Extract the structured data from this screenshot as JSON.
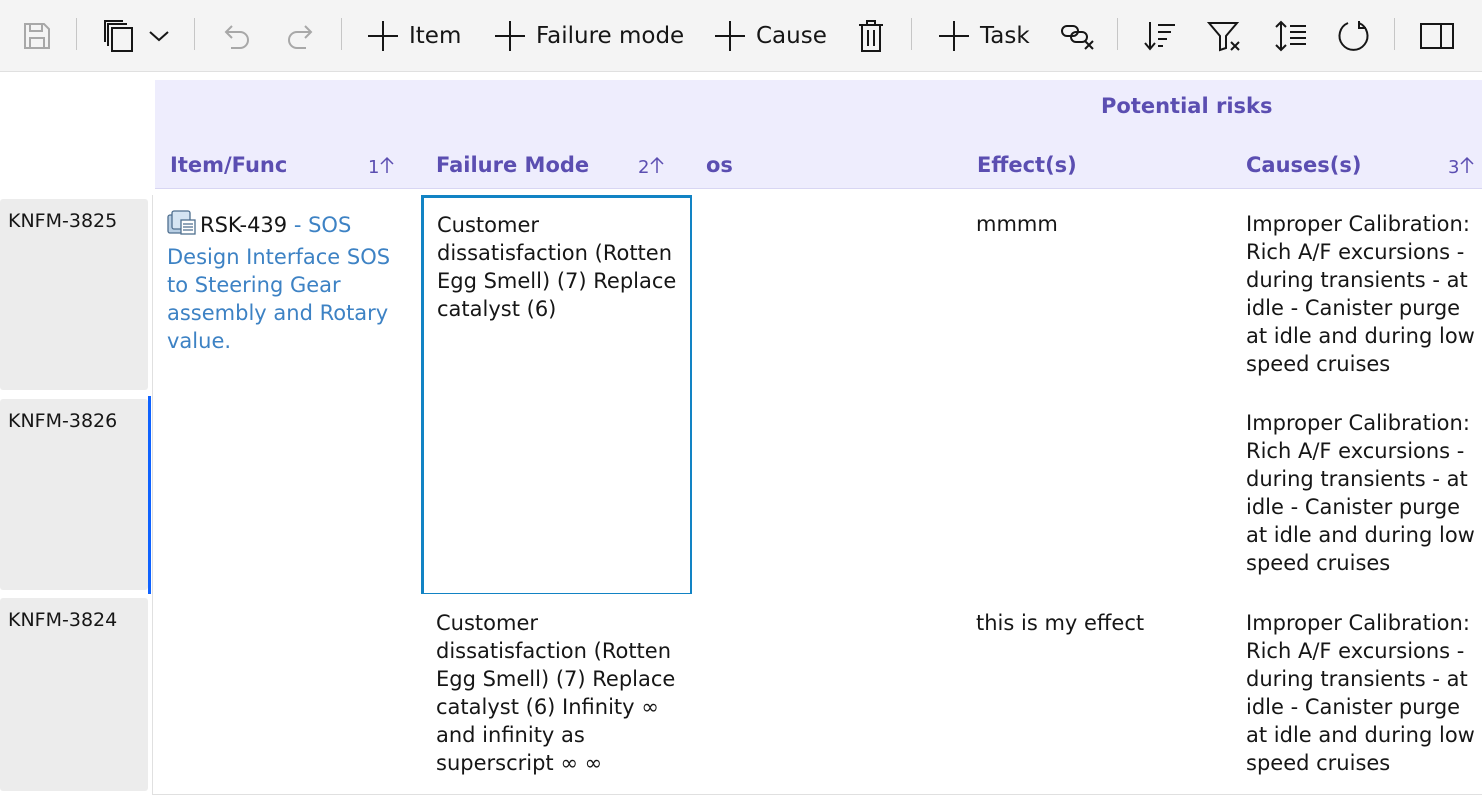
{
  "toolbar": {
    "save_icon": "save-icon",
    "copy_icon": "copy-icon",
    "add_item": "Item",
    "add_failure_mode": "Failure mode",
    "add_cause": "Cause",
    "add_task": "Task"
  },
  "header": {
    "group_label": "Potential risks",
    "columns": [
      {
        "label": "Item/Func",
        "sort": "1"
      },
      {
        "label": "Failure Mode",
        "sort": "2"
      },
      {
        "label": "os",
        "sort": ""
      },
      {
        "label": "Effect(s)",
        "sort": ""
      },
      {
        "label": "Causes(s)",
        "sort": "3"
      }
    ]
  },
  "rows": [
    {
      "id": "KNFM-3825"
    },
    {
      "id": "KNFM-3826"
    },
    {
      "id": "KNFM-3824"
    }
  ],
  "item": {
    "code": "RSK-439",
    "title": "- SOS Design Interface SOS to Steering Gear assembly and Rotary value."
  },
  "failure_modes": [
    "Customer dissatisfaction (Rotten Egg Smell) (7) Replace catalyst (6)",
    "Customer dissatisfaction (Rotten Egg Smell) (7) Replace catalyst (6) Infinity ∞ and infinity as superscript ∞ ∞"
  ],
  "effects": [
    "mmmm",
    "this is my effect"
  ],
  "causes": [
    "Improper Calibration: Rich A/F excursions - during transients - at idle - Canister purge at idle and during low speed cruises",
    "Improper Calibration: Rich A/F excursions - during transients - at idle - Canister purge at idle and during low speed cruises",
    "Improper Calibration: Rich A/F excursions - during transients - at idle - Canister purge at idle and during low speed cruises"
  ],
  "colors": {
    "header_bg": "#eeedfd",
    "header_text": "#5b4eb1",
    "link": "#3d82c4",
    "selection": "#1283c4"
  }
}
